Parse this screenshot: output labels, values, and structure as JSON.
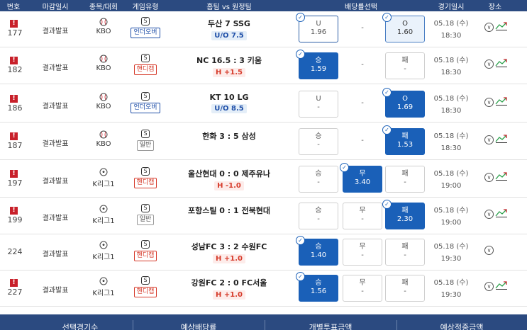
{
  "headers": [
    "번호",
    "마감일시",
    "종목/대회",
    "게임유형",
    "홈팀 vs 원정팀",
    "배당률선택",
    "경기일시",
    "장소"
  ],
  "rows": [
    {
      "no": "177",
      "flag": "!",
      "status": "결과발표",
      "league": "KBO",
      "sport_icon": "baseball-icon",
      "game_type": "언더오버",
      "game_type_kind": "uo",
      "teams": "두산   7   SSG",
      "line": "U/O 7.5",
      "line_kind": "uo",
      "odds": [
        {
          "label": "U",
          "value": "1.96",
          "state": "out"
        },
        {
          "label": "-",
          "value": "",
          "state": "draw"
        },
        {
          "label": "O",
          "value": "1.60",
          "state": "hl"
        }
      ],
      "date": "05.18 (수)",
      "time": "18:30"
    },
    {
      "no": "182",
      "flag": "!",
      "status": "결과발표",
      "league": "KBO",
      "sport_icon": "baseball-icon",
      "game_type": "핸디캡",
      "game_type_kind": "hc",
      "teams": "NC 16.5 : 3 키움",
      "line": "H +1.5",
      "line_kind": "hc",
      "odds": [
        {
          "label": "승",
          "value": "1.59",
          "state": "sel"
        },
        {
          "label": "-",
          "value": "",
          "state": "draw"
        },
        {
          "label": "패",
          "value": "-",
          "state": "normal"
        }
      ],
      "date": "05.18 (수)",
      "time": "18:30"
    },
    {
      "no": "186",
      "flag": "!",
      "status": "결과발표",
      "league": "KBO",
      "sport_icon": "baseball-icon",
      "game_type": "언더오버",
      "game_type_kind": "uo",
      "teams": "KT  10  LG",
      "line": "U/O 8.5",
      "line_kind": "uo",
      "odds": [
        {
          "label": "U",
          "value": "-",
          "state": "normal"
        },
        {
          "label": "-",
          "value": "",
          "state": "draw"
        },
        {
          "label": "O",
          "value": "1.69",
          "state": "sel"
        }
      ],
      "date": "05.18 (수)",
      "time": "18:30"
    },
    {
      "no": "187",
      "flag": "!",
      "status": "결과발표",
      "league": "KBO",
      "sport_icon": "baseball-icon",
      "game_type": "일반",
      "game_type_kind": "normal",
      "teams": "한화 3 : 5 삼성",
      "line": "",
      "line_kind": "none",
      "odds": [
        {
          "label": "승",
          "value": "-",
          "state": "normal"
        },
        {
          "label": "-",
          "value": "",
          "state": "draw"
        },
        {
          "label": "패",
          "value": "1.53",
          "state": "sel"
        }
      ],
      "date": "05.18 (수)",
      "time": "18:30"
    },
    {
      "no": "197",
      "flag": "!",
      "status": "결과발표",
      "league": "K리그1",
      "sport_icon": "soccer-icon",
      "game_type": "핸디캡",
      "game_type_kind": "hc",
      "teams": "울산현대 0 : 0 제주유나",
      "line": "H -1.0",
      "line_kind": "hc",
      "odds": [
        {
          "label": "승",
          "value": "-",
          "state": "normal"
        },
        {
          "label": "무",
          "value": "3.40",
          "state": "sel"
        },
        {
          "label": "패",
          "value": "-",
          "state": "normal"
        }
      ],
      "date": "05.18 (수)",
      "time": "19:00"
    },
    {
      "no": "199",
      "flag": "!",
      "status": "결과발표",
      "league": "K리그1",
      "sport_icon": "soccer-icon",
      "game_type": "일반",
      "game_type_kind": "normal",
      "teams": "포항스틸 0 : 1 전북현대",
      "line": "",
      "line_kind": "none",
      "odds": [
        {
          "label": "승",
          "value": "-",
          "state": "normal"
        },
        {
          "label": "무",
          "value": "-",
          "state": "normal"
        },
        {
          "label": "패",
          "value": "2.30",
          "state": "sel"
        }
      ],
      "date": "05.18 (수)",
      "time": "19:00"
    },
    {
      "no": "224",
      "flag": "",
      "status": "결과발표",
      "league": "K리그1",
      "sport_icon": "soccer-icon",
      "game_type": "핸디캡",
      "game_type_kind": "hc",
      "teams": "성남FC 3 : 2 수원FC",
      "line": "H +1.0",
      "line_kind": "hc",
      "odds": [
        {
          "label": "승",
          "value": "1.40",
          "state": "sel"
        },
        {
          "label": "무",
          "value": "-",
          "state": "normal"
        },
        {
          "label": "패",
          "value": "-",
          "state": "normal"
        }
      ],
      "date": "05.18 (수)",
      "time": "19:30"
    },
    {
      "no": "227",
      "flag": "!",
      "status": "결과발표",
      "league": "K리그1",
      "sport_icon": "soccer-icon",
      "game_type": "핸디캡",
      "game_type_kind": "hc",
      "teams": "강원FC 2 : 0 FC서울",
      "line": "H +1.0",
      "line_kind": "hc",
      "odds": [
        {
          "label": "승",
          "value": "1.56",
          "state": "sel"
        },
        {
          "label": "무",
          "value": "-",
          "state": "normal"
        },
        {
          "label": "패",
          "value": "-",
          "state": "normal"
        }
      ],
      "date": "05.18 (수)",
      "time": "19:30"
    }
  ],
  "footer": [
    "선택경기수",
    "예상배당률",
    "개별투표금액",
    "예상적중금액"
  ],
  "icons": {
    "place": "map-pin-icon",
    "chart": "trend-chart-icon",
    "check": "check-icon",
    "game_type": "s-badge-icon"
  },
  "colors": {
    "header_bg": "#2b4a80",
    "selected": "#1a60b8",
    "flag": "#c8202a",
    "handicap": "#d63a2a",
    "underover": "#1f4fa8"
  }
}
